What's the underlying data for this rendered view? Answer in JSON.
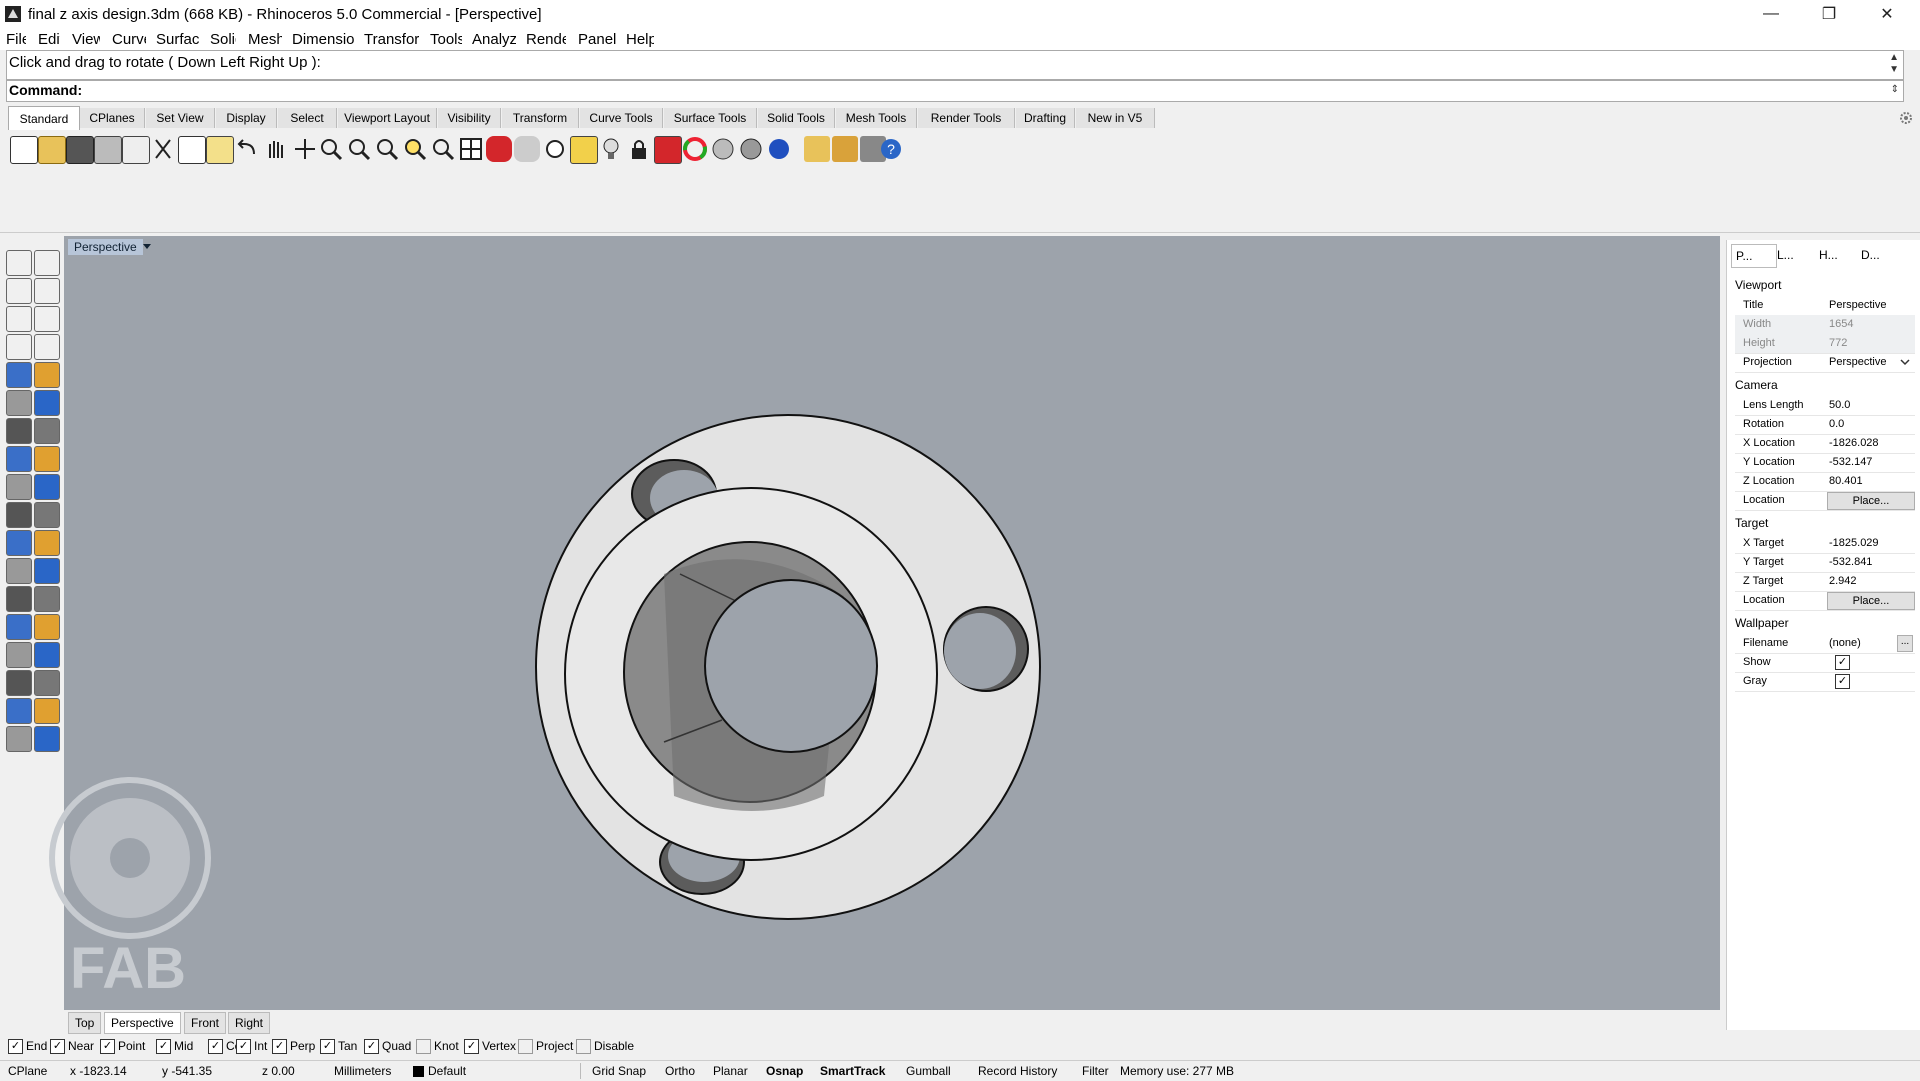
{
  "window": {
    "title": "final z axis design.3dm (668 KB) - Rhinoceros 5.0 Commercial - [Perspective]",
    "minimize": "—",
    "maximize": "❐",
    "close": "✕"
  },
  "menu": [
    "File",
    "Edit",
    "View",
    "Curve",
    "Surface",
    "Solid",
    "Mesh",
    "Dimension",
    "Transform",
    "Tools",
    "Analyze",
    "Render",
    "Panels",
    "Help"
  ],
  "command": {
    "history": "Click and drag to rotate ( Down  Left  Right  Up ):",
    "prompt": "Command:"
  },
  "toolbar_tabs": [
    "Standard",
    "CPlanes",
    "Set View",
    "Display",
    "Select",
    "Viewport Layout",
    "Visibility",
    "Transform",
    "Curve Tools",
    "Surface Tools",
    "Solid Tools",
    "Mesh Tools",
    "Render Tools",
    "Drafting",
    "New in V5"
  ],
  "toolbar_icons": [
    "new-icon",
    "open-icon",
    "save-icon",
    "print-icon",
    "import-icon",
    "cut-icon",
    "copy-icon",
    "paste-icon",
    "undo-icon",
    "pan-hand-icon",
    "rotate-view-icon",
    "zoom-icon",
    "zoom-window-icon",
    "zoom-extents-icon",
    "zoom-selected-icon",
    "zoom-all-icon",
    "four-viewports-icon",
    "car-icon",
    "perspective-icon",
    "match-properties-icon",
    "layer-icon",
    "light-icon",
    "lock-icon",
    "material-icon",
    "color-wheel-icon",
    "sphere-icon",
    "render-icon",
    "blue-sphere-icon",
    "object-snap-icon",
    "gear-icon",
    "tools-icon",
    "help-icon"
  ],
  "left_tools": [
    "select-arrow-icon",
    "point-icon",
    "polyline-icon",
    "rectangle-icon",
    "circle-icon",
    "arc-icon",
    "curve-icon",
    "ellipse-icon",
    "polygon-icon",
    "text-icon",
    "surface-icon",
    "extrude-icon",
    "box-icon",
    "sphere-solid-icon",
    "cylinder-icon",
    "mesh-icon",
    "boolean-icon",
    "explode-icon",
    "fillet-icon",
    "offset-icon",
    "trim-icon",
    "split-icon",
    "join-icon",
    "group-icon",
    "move-icon",
    "rotate-icon",
    "text-tool-icon",
    "dimension-icon",
    "block-icon",
    "array-icon",
    "layout-icon",
    "array-grid-icon",
    "analyze-icon",
    "check-icon",
    "render-obj-icon",
    "light-cone-icon"
  ],
  "viewport": {
    "label": "Perspective",
    "tabs": [
      "Top",
      "Perspective",
      "Front",
      "Right"
    ],
    "active_tab": "Perspective",
    "watermark": "FAB"
  },
  "panel": {
    "tabs": [
      "P...",
      "L...",
      "H...",
      "D..."
    ],
    "sections": {
      "viewport": "Viewport",
      "camera": "Camera",
      "target": "Target",
      "wallpaper": "Wallpaper"
    },
    "viewport_rows": [
      {
        "key": "Title",
        "value": "Perspective"
      },
      {
        "key": "Width",
        "value": "1654"
      },
      {
        "key": "Height",
        "value": "772"
      },
      {
        "key": "Projection",
        "value": "Perspective"
      }
    ],
    "camera_rows": [
      {
        "key": "Lens Length",
        "value": "50.0"
      },
      {
        "key": "Rotation",
        "value": "0.0"
      },
      {
        "key": "X Location",
        "value": "-1826.028"
      },
      {
        "key": "Y Location",
        "value": "-532.147"
      },
      {
        "key": "Z Location",
        "value": "80.401"
      },
      {
        "key": "Location",
        "value": "Place..."
      }
    ],
    "target_rows": [
      {
        "key": "X Target",
        "value": "-1825.029"
      },
      {
        "key": "Y Target",
        "value": "-532.841"
      },
      {
        "key": "Z Target",
        "value": "2.942"
      },
      {
        "key": "Location",
        "value": "Place..."
      }
    ],
    "wallpaper_rows": [
      {
        "key": "Filename",
        "value": "(none)"
      },
      {
        "key": "Show",
        "value": "✓"
      },
      {
        "key": "Gray",
        "value": "✓"
      }
    ],
    "browse": "..."
  },
  "osnaps": [
    {
      "label": "End",
      "checked": true
    },
    {
      "label": "Near",
      "checked": true
    },
    {
      "label": "Point",
      "checked": true
    },
    {
      "label": "Mid",
      "checked": true
    },
    {
      "label": "Cen",
      "checked": true
    },
    {
      "label": "Int",
      "checked": true
    },
    {
      "label": "Perp",
      "checked": true
    },
    {
      "label": "Tan",
      "checked": true
    },
    {
      "label": "Quad",
      "checked": true
    },
    {
      "label": "Knot",
      "checked": false
    },
    {
      "label": "Vertex",
      "checked": true
    },
    {
      "label": "Project",
      "checked": false
    },
    {
      "label": "Disable",
      "checked": false
    }
  ],
  "status": {
    "cplane": "CPlane",
    "x": "x -1823.14",
    "y": "y -541.35",
    "z": "z 0.00",
    "units": "Millimeters",
    "layer": "Default",
    "grid_snap": "Grid Snap",
    "ortho": "Ortho",
    "planar": "Planar",
    "osnap": "Osnap",
    "smarttrack": "SmartTrack",
    "gumball": "Gumball",
    "record_history": "Record History",
    "filter": "Filter",
    "memory": "Memory use: 277 MB"
  },
  "colors": {
    "viewport_bg": "#9da3ab",
    "part_face": "#e3e3e3",
    "part_edge": "#111111",
    "accent": "#2a66c7"
  }
}
